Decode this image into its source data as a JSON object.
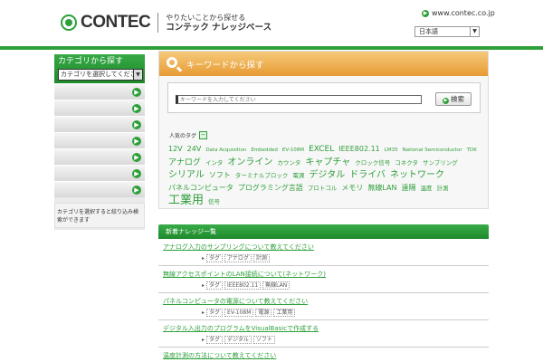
{
  "header": {
    "logo": "CONTEC",
    "tagline_line1": "やりたいことから探せる",
    "tagline_line2": "コンテック ナレッジベース",
    "site_link": "www.contec.co.jp",
    "language_select": "日本語"
  },
  "sidebar": {
    "title": "カテゴリから探す",
    "select_value": "カテゴリを選択してください",
    "items": [
      "",
      "",
      "",
      "",
      "",
      "",
      ""
    ],
    "note": "カテゴリを選択すると絞り込み検索ができます"
  },
  "search": {
    "title": "キーワードから探す",
    "placeholder": "キーワードを入力してください",
    "button_label": "検索",
    "tags_label": "人気のタグ",
    "toggle": "−"
  },
  "tags": [
    {
      "text": "12V",
      "size": 8
    },
    {
      "text": "24V",
      "size": 8
    },
    {
      "text": "Data Acquisition",
      "size": 5.5
    },
    {
      "text": "Embedded",
      "size": 5.5
    },
    {
      "text": "EV-108M",
      "size": 5.5
    },
    {
      "text": "EXCEL",
      "size": 9
    },
    {
      "text": "IEEE802.11",
      "size": 8
    },
    {
      "text": "LM35",
      "size": 5.5
    },
    {
      "text": "National Semiconductor",
      "size": 5.5
    },
    {
      "text": "TDK",
      "size": 5.5
    },
    {
      "text": "アナログ",
      "size": 9
    },
    {
      "text": "インタ",
      "size": 6.5
    },
    {
      "text": "オンライン",
      "size": 10
    },
    {
      "text": "カウンタ",
      "size": 6.5
    },
    {
      "text": "キャプチャ",
      "size": 10
    },
    {
      "text": "クロック信号",
      "size": 6.5
    },
    {
      "text": "コネクタ",
      "size": 6.5
    },
    {
      "text": "サンプリング",
      "size": 6.5
    },
    {
      "text": "シリアル",
      "size": 10
    },
    {
      "text": "ソフト",
      "size": 8
    },
    {
      "text": "ターミナルブロック",
      "size": 6.5
    },
    {
      "text": "電源",
      "size": 6.5
    },
    {
      "text": "デジタル",
      "size": 10
    },
    {
      "text": "ドライバ",
      "size": 10
    },
    {
      "text": "ネットワーク",
      "size": 10
    },
    {
      "text": "パネルコンピュータ",
      "size": 8
    },
    {
      "text": "プログラミング言語",
      "size": 8
    },
    {
      "text": "プロトコル",
      "size": 6.5
    },
    {
      "text": "メモリ",
      "size": 8
    },
    {
      "text": "無線LAN",
      "size": 8
    },
    {
      "text": "遠隔",
      "size": 8
    },
    {
      "text": "温度",
      "size": 6.5
    },
    {
      "text": "計測",
      "size": 6.5
    },
    {
      "text": "工業用",
      "size": 13
    },
    {
      "text": "信号",
      "size": 6.5
    }
  ],
  "news": {
    "title": "新着ナレッジ一覧",
    "rows": [
      {
        "title": "アナログ入力のサンプリングについて教えてください",
        "tags": [
          "タグ",
          "アナログ",
          "計測"
        ]
      },
      {
        "title": "無線アクセスポイントのLAN接続について(ネットワーク)",
        "tags": [
          "タグ",
          "IEEE802.11",
          "無線LAN"
        ]
      },
      {
        "title": "パネルコンピュータの電源について教えてください",
        "tags": [
          "タグ",
          "EV-108M",
          "電源",
          "工業用"
        ]
      },
      {
        "title": "デジタル入出力のプログラムをVisualBasicで作成する",
        "tags": [
          "タグ",
          "デジタル",
          "ソフト"
        ]
      },
      {
        "title": "温度計測の方法について教えてください",
        "tags": [
          "タグ",
          "温度"
        ]
      }
    ]
  }
}
